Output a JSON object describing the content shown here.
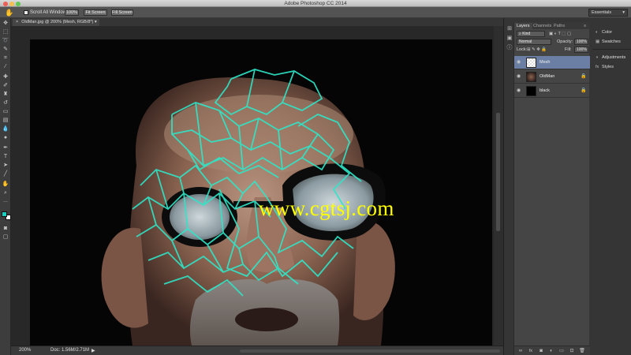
{
  "window": {
    "title": "Adobe Photoshop CC 2014"
  },
  "options_bar": {
    "scroll_all_windows": "Scroll All Windows",
    "btn_100": "100%",
    "btn_fit": "Fit Screen",
    "btn_fill": "Fill Screen",
    "workspace": "Essentials"
  },
  "document": {
    "tab_title": "OldMan.jpg @ 200% (Mesh, RGB/8*)",
    "watermark": "www.cgtsj.com"
  },
  "status": {
    "zoom": "200%",
    "doc_size": "Doc: 1.56M/2.71M"
  },
  "layers_panel": {
    "tabs": [
      "Layers",
      "Channels",
      "Paths"
    ],
    "filter": "Kind",
    "blend_mode": "Normal",
    "opacity_label": "Opacity:",
    "opacity": "100%",
    "lock_label": "Lock:",
    "fill_label": "Fill:",
    "fill": "100%",
    "layers": [
      {
        "name": "Mesh",
        "locked": false
      },
      {
        "name": "OldMan",
        "locked": true
      },
      {
        "name": "black",
        "locked": true
      }
    ]
  },
  "dock": {
    "items": [
      "Color",
      "Swatches",
      "Adjustments",
      "Styles"
    ]
  },
  "colors": {
    "foreground": "#18d0c0",
    "background": "#ffffff",
    "mesh": "#2fe6c8",
    "watermark": "#ffff00"
  }
}
